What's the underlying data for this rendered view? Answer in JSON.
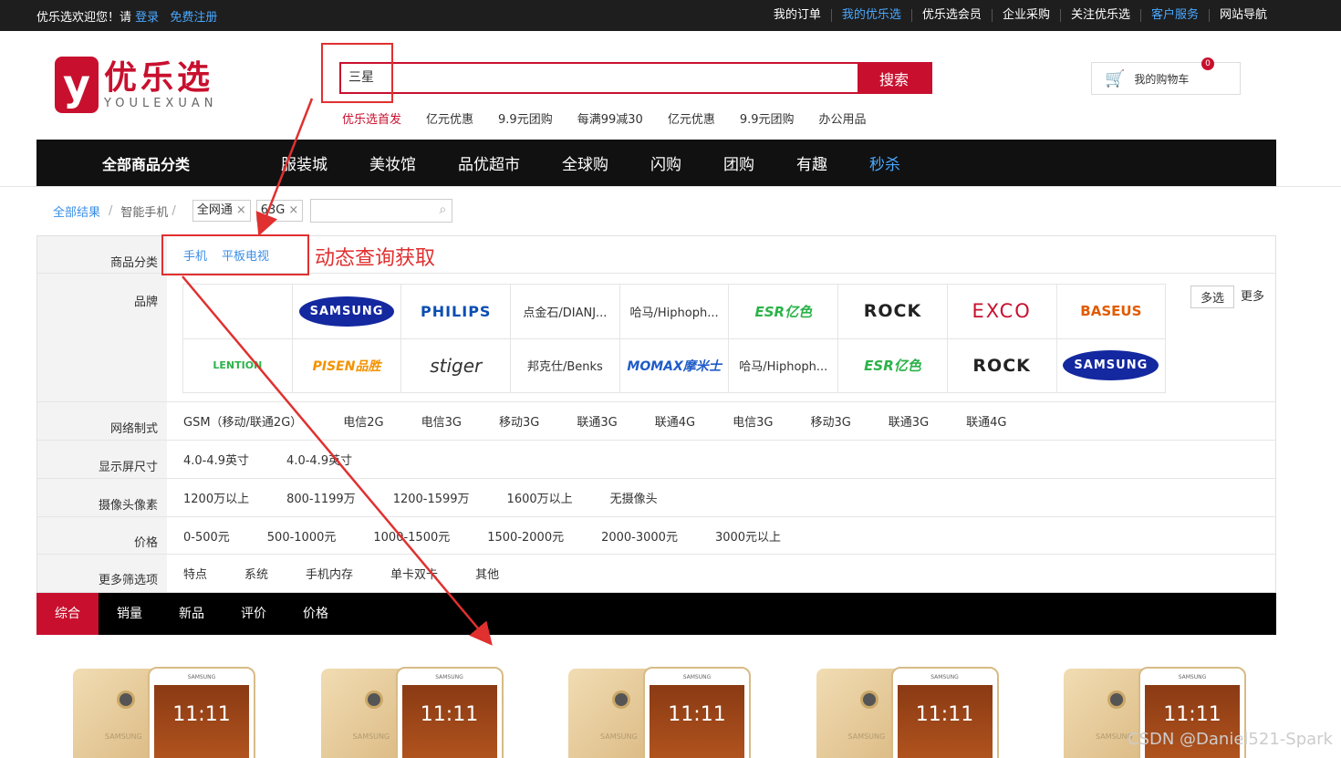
{
  "topbar": {
    "welcome": "优乐选欢迎您！请",
    "login": "登录",
    "register": "免费注册",
    "links": [
      "我的订单",
      "我的优乐选",
      "优乐选会员",
      "企业采购",
      "关注优乐选",
      "客户服务",
      "网站导航"
    ]
  },
  "logo": {
    "letter": "y",
    "name": "优乐选",
    "pinyin": "YOULEXUAN"
  },
  "search": {
    "query": "三星",
    "button": "搜索"
  },
  "hotwords": [
    "优乐选首发",
    "亿元优惠",
    "9.9元团购",
    "每满99减30",
    "亿元优惠",
    "9.9元团购",
    "办公用品"
  ],
  "cart": {
    "label": "我的购物车",
    "count": "0"
  },
  "mainnav": {
    "all": "全部商品分类",
    "items": [
      "服装城",
      "美妆馆",
      "品优超市",
      "全球购",
      "闪购",
      "团购",
      "有趣",
      "秒杀"
    ]
  },
  "crumbs": {
    "all": "全部结果",
    "category": "智能手机",
    "tags": [
      "全网通",
      "63G"
    ]
  },
  "filters": {
    "category": {
      "label": "商品分类",
      "values": [
        "手机",
        "平板电视"
      ]
    },
    "brand": {
      "label": "品牌",
      "multi": "多选",
      "more": "更多",
      "items": [
        "",
        "SAMSUNG",
        "PHILIPS",
        "点金石/DIANJ...",
        "哈马/Hiphoph...",
        "ESR亿色",
        "ROCK",
        "EXCO",
        "BASEUS",
        "LENTION",
        "PISEN品胜",
        "stiger",
        "邦克仕/Benks",
        "MOMAX摩米士",
        "哈马/Hiphoph...",
        "ESR亿色",
        "ROCK",
        "SAMSUNG"
      ]
    },
    "network": {
      "label": "网络制式",
      "values": [
        "GSM（移动/联通2G）",
        "电信2G",
        "电信3G",
        "移动3G",
        "联通3G",
        "联通4G",
        "电信3G",
        "移动3G",
        "联通3G",
        "联通4G"
      ]
    },
    "screen": {
      "label": "显示屏尺寸",
      "values": [
        "4.0-4.9英寸",
        "4.0-4.9英寸"
      ]
    },
    "camera": {
      "label": "摄像头像素",
      "values": [
        "1200万以上",
        "800-1199万",
        "1200-1599万",
        "1600万以上",
        "无摄像头"
      ]
    },
    "price": {
      "label": "价格",
      "values": [
        "0-500元",
        "500-1000元",
        "1000-1500元",
        "1500-2000元",
        "2000-3000元",
        "3000元以上"
      ]
    },
    "more_options": {
      "label": "更多筛选项",
      "values": [
        "特点",
        "系统",
        "手机内存",
        "单卡双卡",
        "其他"
      ]
    }
  },
  "sortbar": [
    "综合",
    "销量",
    "新品",
    "评价",
    "价格"
  ],
  "products": [
    {
      "time": "11:11",
      "brand": "SAMSUNG"
    },
    {
      "time": "11:11",
      "brand": "SAMSUNG"
    },
    {
      "time": "11:11",
      "brand": "SAMSUNG"
    },
    {
      "time": "11:11",
      "brand": "SAMSUNG"
    },
    {
      "time": "11:11",
      "brand": "SAMSUNG"
    }
  ],
  "annotation": "动态查询获取",
  "watermark": "CSDN @Daniel521-Spark",
  "colors": {
    "brand_red": "#c8102e",
    "annotation_red": "#e03030",
    "link_blue": "#3a8ee6"
  }
}
